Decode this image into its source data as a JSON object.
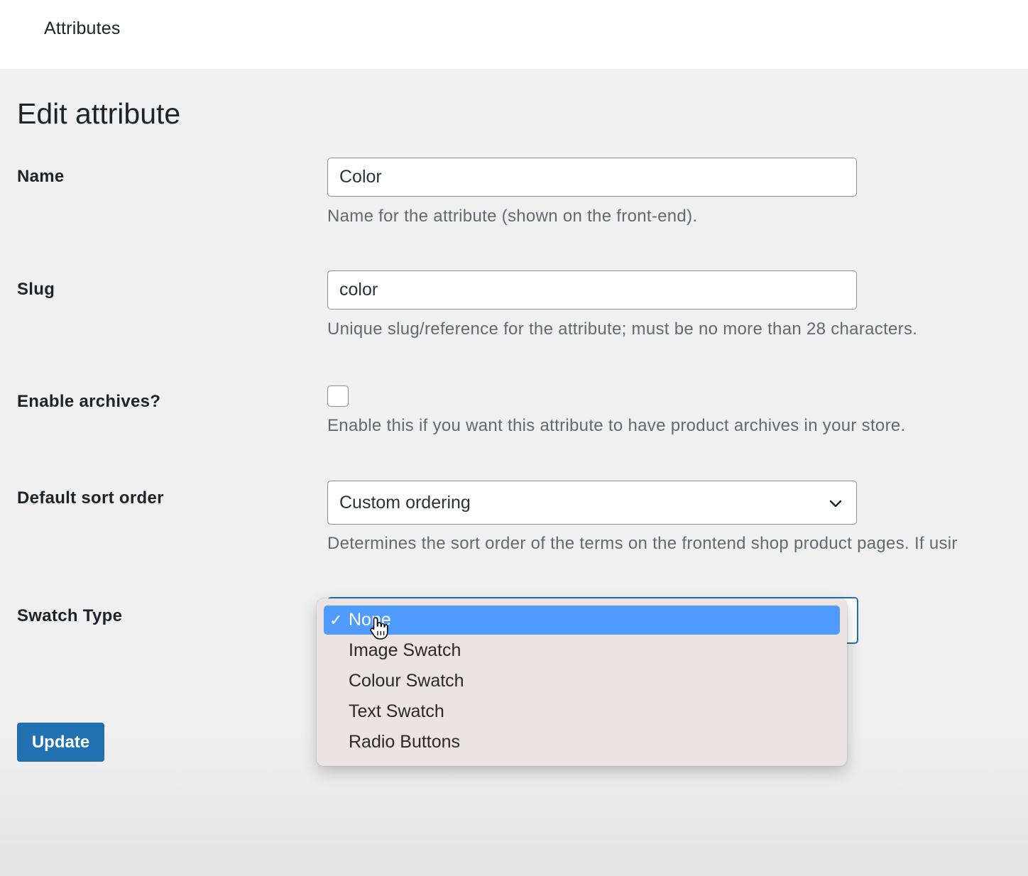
{
  "header": {
    "title": "Attributes"
  },
  "page": {
    "title": "Edit attribute"
  },
  "fields": {
    "name": {
      "label": "Name",
      "value": "Color",
      "description": "Name for the attribute (shown on the front-end)."
    },
    "slug": {
      "label": "Slug",
      "value": "color",
      "description": "Unique slug/reference for the attribute; must be no more than 28 characters."
    },
    "archives": {
      "label": "Enable archives?",
      "checked": false,
      "description": "Enable this if you want this attribute to have product archives in your store."
    },
    "sort_order": {
      "label": "Default sort order",
      "value": "Custom ordering",
      "description": "Determines the sort order of the terms on the frontend shop product pages. If usir"
    },
    "swatch_type": {
      "label": "Swatch Type",
      "selected": "None",
      "options": [
        "None",
        "Image Swatch",
        "Colour Swatch",
        "Text Swatch",
        "Radio Buttons"
      ]
    }
  },
  "actions": {
    "update_label": "Update"
  },
  "icons": {
    "check": "checkmark-icon",
    "chevron": "chevron-down-icon",
    "cursor": "hand-pointer-icon"
  },
  "colors": {
    "primary": "#2271b1",
    "selected_option": "#4f9bff",
    "dropdown_bg": "#ece3e3"
  }
}
